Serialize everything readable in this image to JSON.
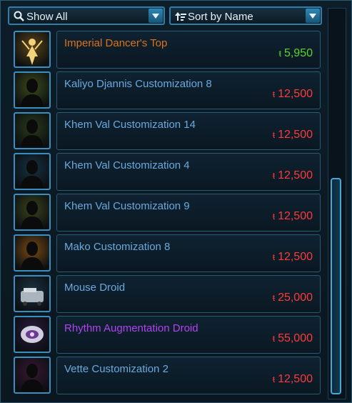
{
  "filter": {
    "label": "Show All",
    "icon": "magnifier-icon"
  },
  "sort": {
    "label": "Sort by Name",
    "icon": "sort-arrow-icon"
  },
  "currency_symbol": "ŧ",
  "items": [
    {
      "name": "Imperial Dancer's Top",
      "price": "5,950",
      "name_color": "#e0711c",
      "price_color": "#59d62f",
      "icon": "dancer-icon",
      "bg": "#5a4416"
    },
    {
      "name": "Kaliyo Djannis Customization 8",
      "price": "12,500",
      "name_color": "#6aa9de",
      "price_color": "#ff3a3a",
      "icon": "silhouette-icon",
      "bg": "#3d4b1a"
    },
    {
      "name": "Khem Val Customization 14",
      "price": "12,500",
      "name_color": "#6aa9de",
      "price_color": "#ff3a3a",
      "icon": "silhouette-icon",
      "bg": "#2a3b1a"
    },
    {
      "name": "Khem Val Customization 4",
      "price": "12,500",
      "name_color": "#6aa9de",
      "price_color": "#ff3a3a",
      "icon": "silhouette-icon",
      "bg": "#163245"
    },
    {
      "name": "Khem Val Customization 9",
      "price": "12,500",
      "name_color": "#6aa9de",
      "price_color": "#ff3a3a",
      "icon": "silhouette-icon",
      "bg": "#3a441b"
    },
    {
      "name": "Mako Customization 8",
      "price": "12,500",
      "name_color": "#6aa9de",
      "price_color": "#ff3a3a",
      "icon": "silhouette-icon",
      "bg": "#7a4a12"
    },
    {
      "name": "Mouse Droid",
      "price": "25,000",
      "name_color": "#6aa9de",
      "price_color": "#ff3a3a",
      "icon": "droid-icon",
      "bg": "#1c3344"
    },
    {
      "name": "Rhythm Augmentation Droid",
      "price": "55,000",
      "name_color": "#b044ee",
      "price_color": "#ff3a3a",
      "icon": "augment-droid-icon",
      "bg": "#2d1a3f"
    },
    {
      "name": "Vette Customization 2",
      "price": "12,500",
      "name_color": "#6aa9de",
      "price_color": "#ff3a3a",
      "icon": "silhouette-icon",
      "bg": "#3a1733"
    }
  ]
}
